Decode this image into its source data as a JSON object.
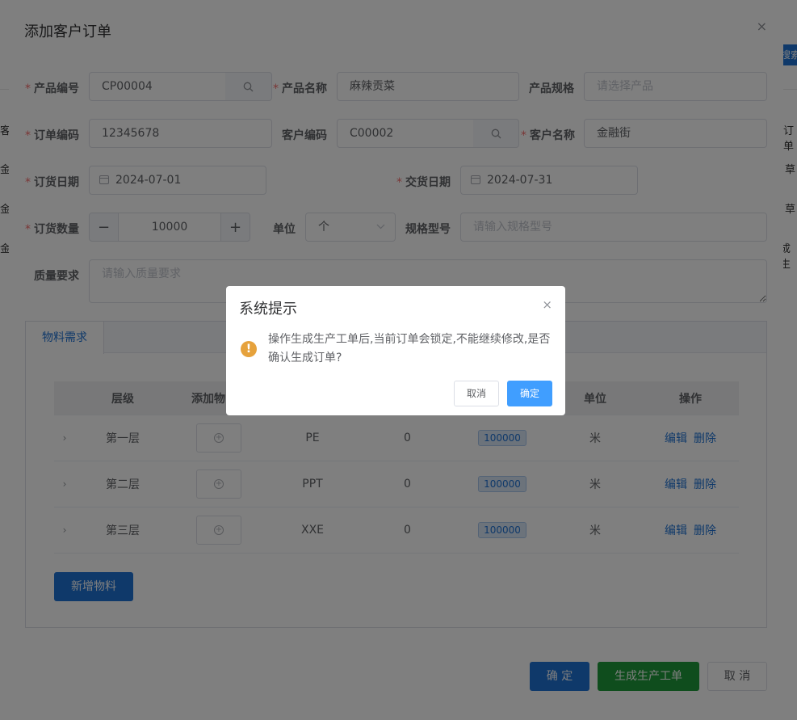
{
  "background": {
    "search_btn": "搜索",
    "frag_1": "客",
    "frag_2": "订单",
    "frag_3": "草",
    "frag_4": "草",
    "frag_5": "成生",
    "frag_6": "金",
    "frag_7": "金",
    "frag_8": "金"
  },
  "dialog": {
    "title": "添加客户订单",
    "close": "×"
  },
  "form": {
    "product_code": {
      "label": "产品编号",
      "value": "CP00004"
    },
    "product_name": {
      "label": "产品名称",
      "value": "麻辣贡菜"
    },
    "product_spec": {
      "label": "产品规格",
      "placeholder": "请选择产品"
    },
    "order_code": {
      "label": "订单编码",
      "value": "12345678"
    },
    "customer_code": {
      "label": "客户编码",
      "value": "C00002"
    },
    "customer_name": {
      "label": "客户名称",
      "value": "金融街"
    },
    "order_date": {
      "label": "订货日期",
      "value": "2024-07-01"
    },
    "delivery_date": {
      "label": "交货日期",
      "value": "2024-07-31"
    },
    "order_qty": {
      "label": "订货数量",
      "value": "10000",
      "minus": "−",
      "plus": "+"
    },
    "unit": {
      "label": "单位",
      "value": "个"
    },
    "model": {
      "label": "规格型号",
      "placeholder": "请输入规格型号"
    },
    "quality": {
      "label": "质量要求",
      "placeholder": "请输入质量要求"
    }
  },
  "tabs": {
    "active": "物料需求"
  },
  "table": {
    "headers": [
      "层级",
      "添加物",
      "",
      "",
      "",
      "单位",
      "操作"
    ],
    "rows": [
      {
        "level": "第一层",
        "name": "PE",
        "value": "0",
        "qty": "100000",
        "unit": "米",
        "edit": "编辑",
        "delete": "删除"
      },
      {
        "level": "第二层",
        "name": "PPT",
        "value": "0",
        "qty": "100000",
        "unit": "米",
        "edit": "编辑",
        "delete": "删除"
      },
      {
        "level": "第三层",
        "name": "XXE",
        "value": "0",
        "qty": "100000",
        "unit": "米",
        "edit": "编辑",
        "delete": "删除"
      }
    ]
  },
  "buttons": {
    "add_material": "新增物料",
    "confirm": "确 定",
    "generate": "生成生产工单",
    "cancel": "取 消"
  },
  "confirm_dialog": {
    "title": "系统提示",
    "close": "×",
    "icon": "!",
    "message": "操作生成生产工单后,当前订单会锁定,不能继续修改,是否确认生成订单?",
    "cancel": "取消",
    "ok": "确定"
  },
  "colors": {
    "primary": "#1f72d4",
    "success": "#1f9b3a",
    "warning": "#e6a23c",
    "confirm_ok": "#409eff",
    "required": "#f56c6c"
  }
}
